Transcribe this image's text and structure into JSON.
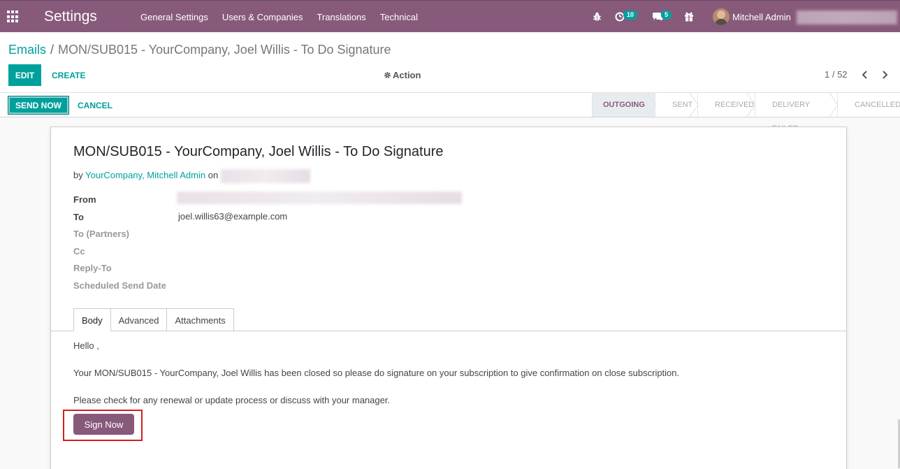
{
  "navbar": {
    "brand": "Settings",
    "menu": [
      "General Settings",
      "Users & Companies",
      "Translations",
      "Technical"
    ],
    "activity_count": "10",
    "message_count": "5",
    "user_name": "Mitchell Admin",
    "color": "#875a7b"
  },
  "breadcrumb": {
    "parent": "Emails",
    "separator": "/",
    "current": "MON/SUB015 - YourCompany, Joel Willis - To Do Signature"
  },
  "toolbar": {
    "edit_label": "EDIT",
    "create_label": "CREATE",
    "action_label": "Action",
    "pager": "1 / 52"
  },
  "statusbar": {
    "send_label": "SEND NOW",
    "cancel_label": "CANCEL",
    "stages": [
      "OUTGOING",
      "SENT",
      "RECEIVED",
      "DELIVERY FAILED",
      "CANCELLED"
    ],
    "active_stage": "OUTGOING"
  },
  "sheet": {
    "title": "MON/SUB015 - YourCompany, Joel Willis - To Do Signature",
    "by_prefix": "by",
    "author": "YourCompany, Mitchell Admin",
    "on_text": "on",
    "fields": {
      "from_label": "From",
      "to_label": "To",
      "to_value": "joel.willis63@example.com",
      "to_partners_label": "To (Partners)",
      "cc_label": "Cc",
      "reply_to_label": "Reply-To",
      "scheduled_label": "Scheduled Send Date"
    },
    "tabs": [
      "Body",
      "Advanced",
      "Attachments"
    ],
    "body": {
      "greeting": "Hello ,",
      "paragraph1": "Your MON/SUB015 - YourCompany, Joel Willis has been closed so please do signature on your subscription to give confirmation on close subscription.",
      "paragraph2": "Please check for any renewal or update process or discuss with your manager.",
      "sign_button": "Sign Now"
    }
  },
  "colors": {
    "primary": "#00a09d",
    "brand": "#875a7b",
    "highlight": "#d41f1f"
  }
}
